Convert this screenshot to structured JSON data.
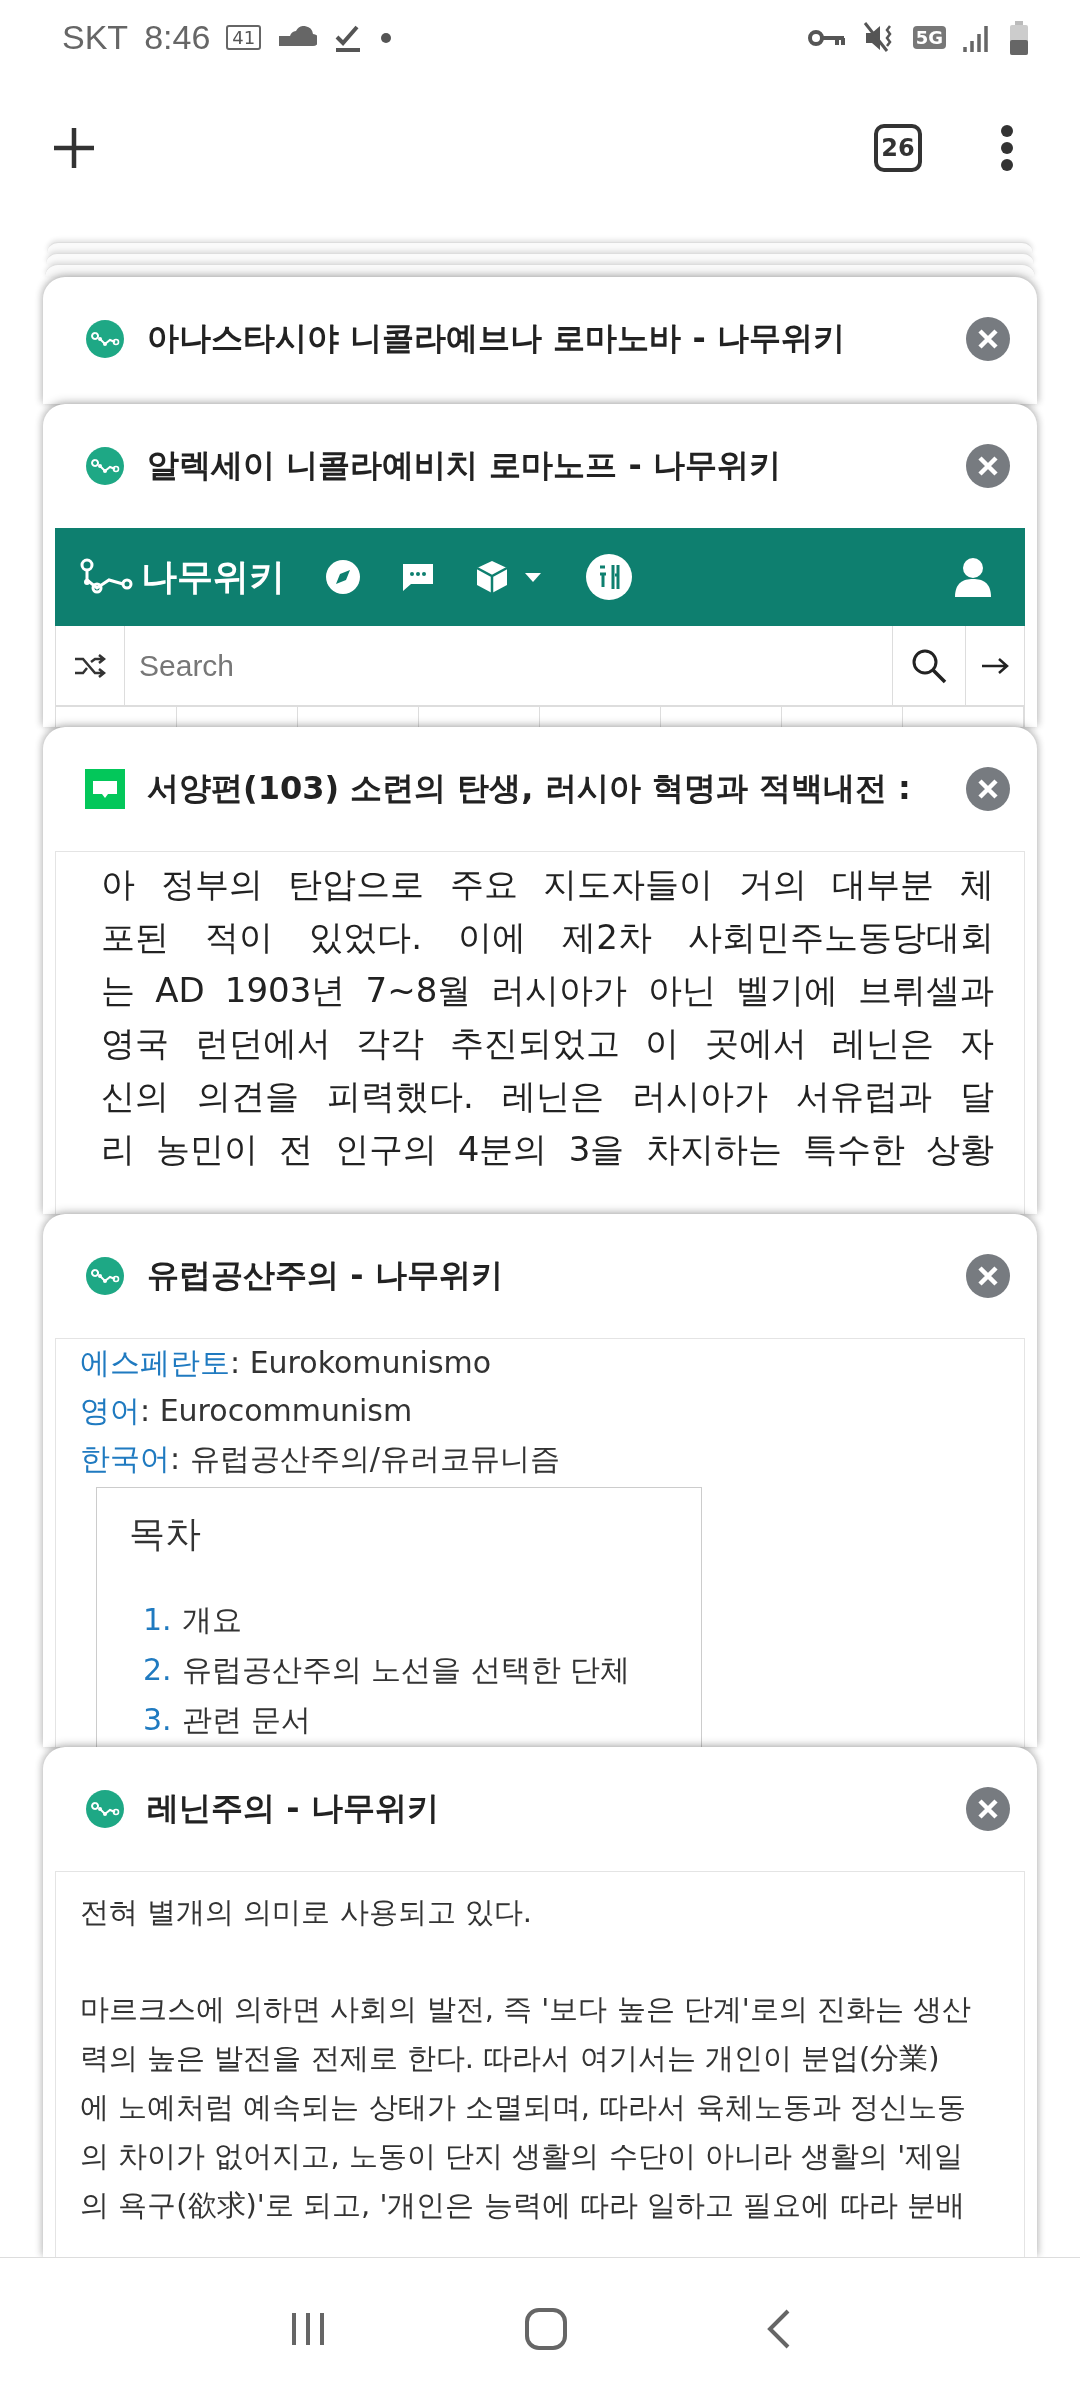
{
  "status_bar": {
    "carrier": "SKT",
    "time": "8:46",
    "notification_badge": "41",
    "network": "5G"
  },
  "toolbar": {
    "tab_count": "26"
  },
  "tabs": [
    {
      "kind": "namu",
      "title": "아나스타시야 니콜라예브나 로마노바 - 나무위키",
      "preview": {
        "kind": "none"
      }
    },
    {
      "kind": "namu",
      "title": "알렉세이 니콜라예비치 로마노프 - 나무위키",
      "preview": {
        "kind": "wiki_header",
        "logo": "나무위키",
        "search_placeholder": "Search"
      }
    },
    {
      "kind": "blog",
      "title": "서양편(103) 소련의 탄생, 러시아 혁명과 적백내전 :",
      "preview": {
        "kind": "justified",
        "lines": [
          "아 정부의 탄압으로 주요 지도자들이 거의 대부분 체",
          "포된 적이 있었다. 이에 제2차 사회민주노동당대회",
          "는 AD 1903년 7~8월 러시아가 아닌 벨기에 브뤼셀과",
          "영국 런던에서 각각 추진되었고 이 곳에서 레닌은 자",
          "신의 의견을 피력했다. 레닌은 러시아가 서유럽과 달",
          "리 농민이 전 인구의 4분의 3을 차지하는 특수한 상황"
        ]
      }
    },
    {
      "kind": "namu",
      "title": "유럽공산주의 - 나무위키",
      "preview": {
        "kind": "wiki_info",
        "names": [
          {
            "label": "에스페란토",
            "value": ": Eurokomunismo"
          },
          {
            "label": "영어",
            "value": ": Eurocommunism"
          },
          {
            "label": "한국어",
            "value": ": 유럽공산주의/유러코뮤니즘"
          }
        ],
        "toc": {
          "title": "목차",
          "items": [
            {
              "number": "1.",
              "text": "개요"
            },
            {
              "number": "2.",
              "text": "유럽공산주의 노선을 선택한 단체"
            },
            {
              "number": "3.",
              "text": "관련 문서"
            }
          ]
        }
      }
    },
    {
      "kind": "namu",
      "title": "레닌주의 - 나무위키",
      "preview": {
        "kind": "paragraphs",
        "paragraphs": [
          [
            "전혀 별개의 의미로 사용되고 있다."
          ],
          [
            "마르크스에 의하면 사회의 발전, 즉 '보다 높은 단계'로의 진화는 생산",
            "력의 높은 발전을 전제로 한다. 따라서 여기서는 개인이 분업(分業)",
            "에 노예처럼 예속되는 상태가 소멸되며, 따라서 육체노동과 정신노동",
            "의 차이가 없어지고, 노동이 단지 생활의 수단이 아니라 생활의 '제일",
            "의 욕구(欲求)'로 되고, '개인은 능력에 따라 일하고 필요에 따라 분배"
          ]
        ]
      }
    }
  ]
}
